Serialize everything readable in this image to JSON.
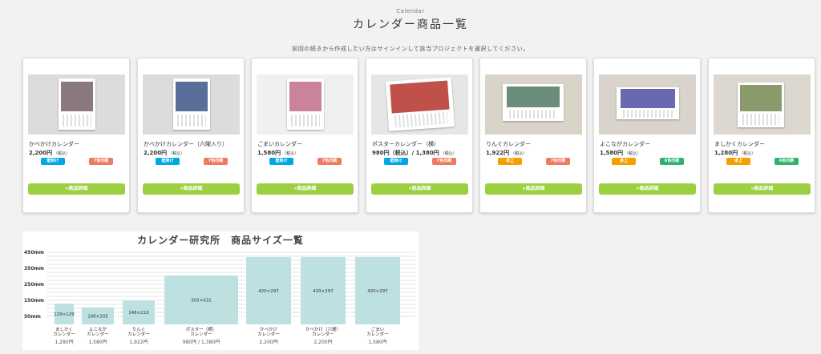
{
  "header": {
    "subtitle": "Calendar",
    "title": "カレンダー商品一覧",
    "note": "前回の続きから作成したい方はサインインして該当プロジェクトを選択してください。"
  },
  "products": [
    {
      "name": "かべかけカレンダー",
      "price": "2,200円",
      "tax": "（税込）",
      "badge1": "壁掛け",
      "badge1_color": "#00a8e8",
      "badge2": "7色印刷",
      "badge2_color": "#ef7a5f",
      "button": "»商品詳細",
      "thumb_bg": "#dcdcdc",
      "photo": "#8a7a80"
    },
    {
      "name": "かべかけカレンダー（六曜入り）",
      "price": "2,200円",
      "tax": "（税込）",
      "badge1": "壁掛け",
      "badge1_color": "#00a8e8",
      "badge2": "7色印刷",
      "badge2_color": "#ef7a5f",
      "button": "»商品詳細",
      "thumb_bg": "#dcdcdc",
      "photo": "#5a6e9a"
    },
    {
      "name": "ごまいカレンダー",
      "price": "1,580円",
      "tax": "（税込）",
      "badge1": "壁掛け",
      "badge1_color": "#00a8e8",
      "badge2": "7色印刷",
      "badge2_color": "#ef7a5f",
      "button": "»商品詳細",
      "thumb_bg": "#f0f0f0",
      "photo": "#c9839a"
    },
    {
      "name": "ポスターカレンダー（横）",
      "price": "980円（税込）/ 1,380円",
      "tax": "（税込）",
      "badge1": "壁掛け",
      "badge1_color": "#00a8e8",
      "badge2": "7色印刷",
      "badge2_color": "#ef7a5f",
      "button": "»商品詳細",
      "thumb_bg": "#e6e6e6",
      "photo": "#c0504a"
    },
    {
      "name": "りんぐカレンダー",
      "price": "1,922円",
      "tax": "（税込）",
      "badge1": "卓上",
      "badge1_color": "#f5a000",
      "badge2": "7色印刷",
      "badge2_color": "#ef7a5f",
      "button": "»商品詳細",
      "thumb_bg": "#d9d4c8",
      "photo": "#6a8c7a"
    },
    {
      "name": "よこながカレンダー",
      "price": "1,580円",
      "tax": "（税込）",
      "badge1": "卓上",
      "badge1_color": "#f5a000",
      "badge2": "6色印刷",
      "badge2_color": "#2db36b",
      "button": "»商品詳細",
      "thumb_bg": "#d8d4cc",
      "photo": "#6a68b0"
    },
    {
      "name": "ましかくカレンダー",
      "price": "1,280円",
      "tax": "（税込）",
      "badge1": "卓上",
      "badge1_color": "#f5a000",
      "badge2": "6色印刷",
      "badge2_color": "#2db36b",
      "button": "»商品詳細",
      "thumb_bg": "#dcd8cf",
      "photo": "#8a9a6a"
    }
  ],
  "chart_data": {
    "type": "bar",
    "title": "カレンダー研究所　商品サイズ一覧",
    "ylabel": "",
    "yticks": [
      "50mm",
      "150mm",
      "250mm",
      "350mm",
      "450mm"
    ],
    "ytick_values": [
      50,
      150,
      250,
      350,
      450
    ],
    "ylim": [
      0,
      450
    ],
    "categories": [
      {
        "name1": "ましかく",
        "name2": "カレンダー",
        "price": "1,280円",
        "label": "129×129",
        "value": 129
      },
      {
        "name1": "よこなが",
        "name2": "カレンダー",
        "price": "1,580円",
        "label": "106×205",
        "value": 106
      },
      {
        "name1": "りんぐ",
        "name2": "カレンダー",
        "price": "1,922円",
        "label": "148×210",
        "value": 148
      },
      {
        "name1": "ポスター（横）",
        "name2": "カレンダー",
        "price": "980円 / 1,380円",
        "label": "305×431",
        "value": 305
      },
      {
        "name1": "かべかけ",
        "name2": "カレンダー",
        "price": "2,200円",
        "label": "420×297",
        "value": 420
      },
      {
        "name1": "かべかけ（六曜）",
        "name2": "カレンダー",
        "price": "2,200円",
        "label": "420×297",
        "value": 420
      },
      {
        "name1": "ごまい",
        "name2": "カレンダー",
        "price": "1,580円",
        "label": "420×297",
        "value": 420
      }
    ],
    "bar_color": "#bde0e0",
    "grid": true
  }
}
